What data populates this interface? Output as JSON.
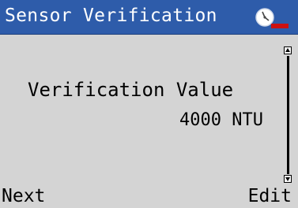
{
  "header": {
    "title": "Sensor Verification",
    "status_icon": "clock-alarm-icon",
    "accent_color": "#2e5caa",
    "alert_color": "#cc1111"
  },
  "main": {
    "label": "Verification Value",
    "value": "4000 NTU"
  },
  "scrollbar": {
    "up_icon": "scroll-up-arrow-icon",
    "down_icon": "scroll-down-arrow-icon"
  },
  "softkeys": {
    "left_label": "Next",
    "right_label": "Edit"
  }
}
